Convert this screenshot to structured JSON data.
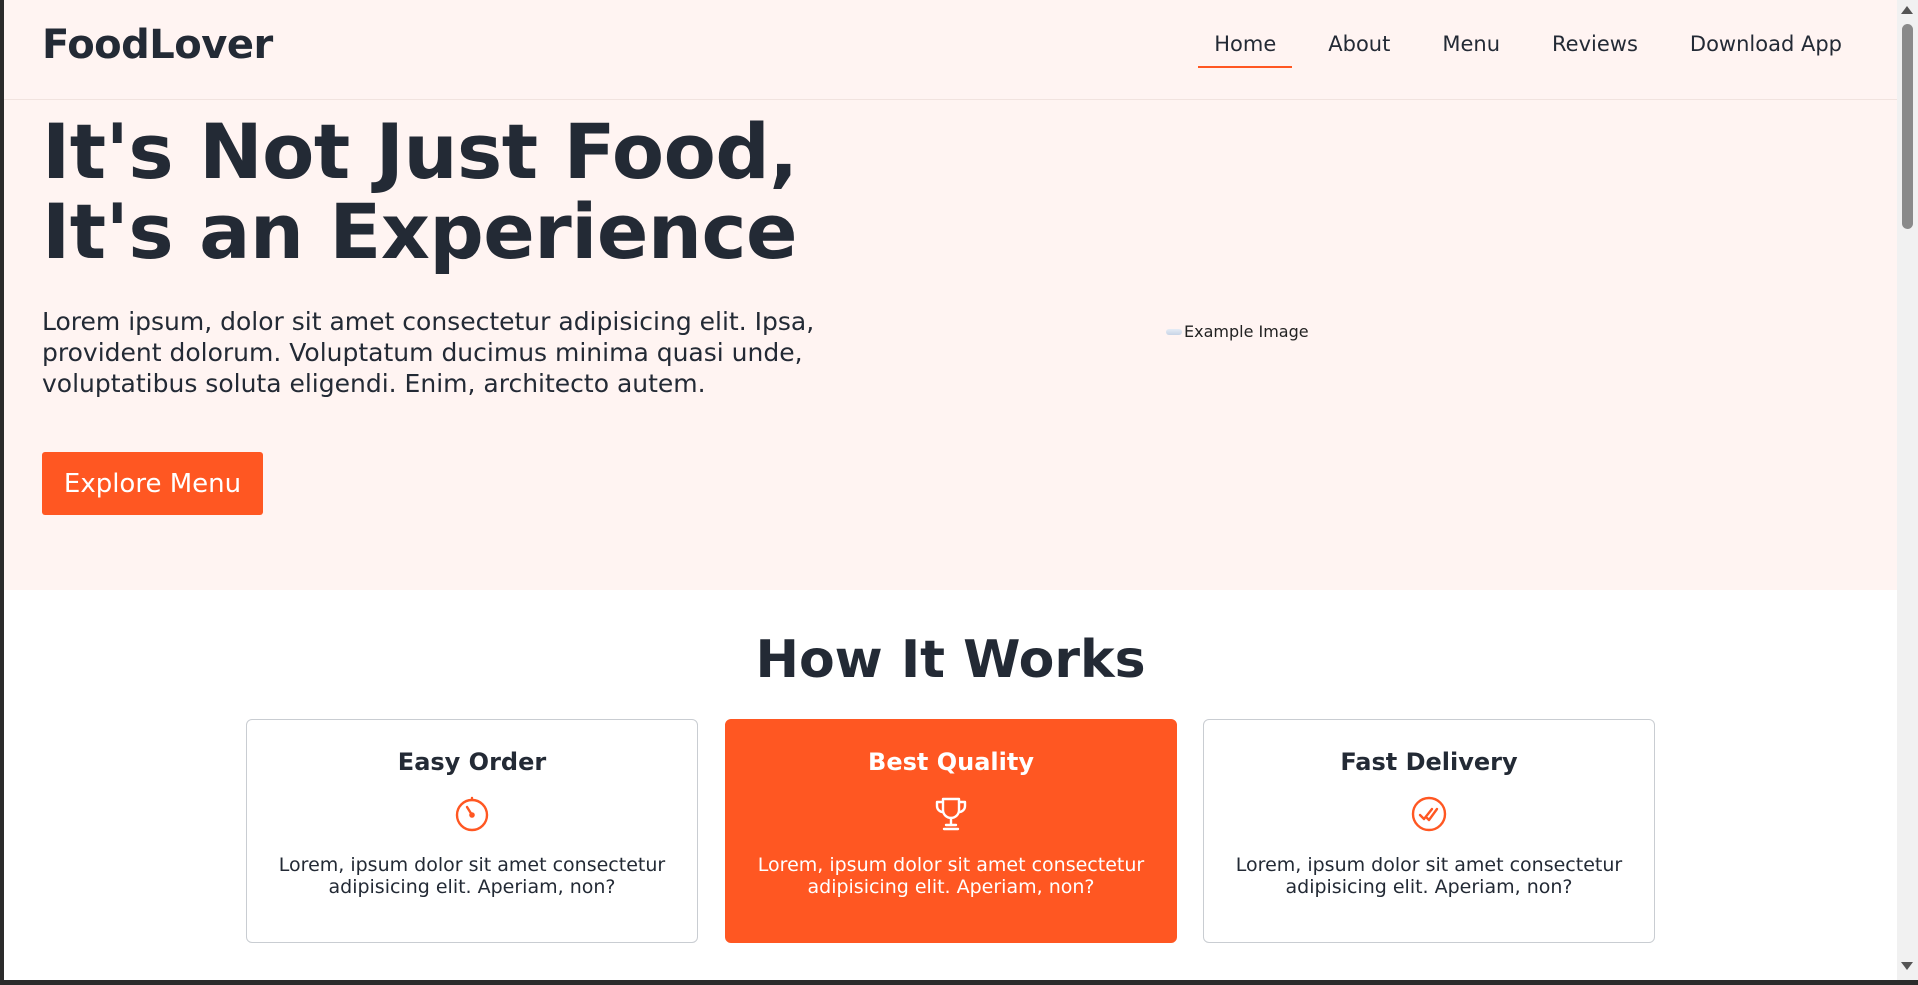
{
  "brand": {
    "name": "FoodLover",
    "accent_color": "#ff5722"
  },
  "nav": {
    "items": [
      {
        "label": "Home",
        "active": true
      },
      {
        "label": "About"
      },
      {
        "label": "Menu"
      },
      {
        "label": "Reviews"
      },
      {
        "label": "Download App"
      }
    ]
  },
  "hero": {
    "title": "It's Not Just Food,\nIt's an Experience",
    "text": "Lorem ipsum, dolor sit amet consectetur adipisicing elit. Ipsa, provident dolorum. Voluptatum ducimus minima quasi unde, voluptatibus soluta eligendi. Enim, architecto autem.",
    "button_label": "Explore Menu",
    "image_alt": "Example Image"
  },
  "how_it_works": {
    "title": "How It Works",
    "cards": [
      {
        "title": "Easy Order",
        "icon": "timer-icon",
        "text": "Lorem, ipsum dolor sit amet consectetur adipisicing elit. Aperiam, non?"
      },
      {
        "title": "Best Quality",
        "icon": "trophy-icon",
        "text": "Lorem, ipsum dolor sit amet consectetur adipisicing elit. Aperiam, non?"
      },
      {
        "title": "Fast Delivery",
        "icon": "check-circle-icon",
        "text": "Lorem, ipsum dolor sit amet consectetur adipisicing elit. Aperiam, non?"
      }
    ]
  }
}
